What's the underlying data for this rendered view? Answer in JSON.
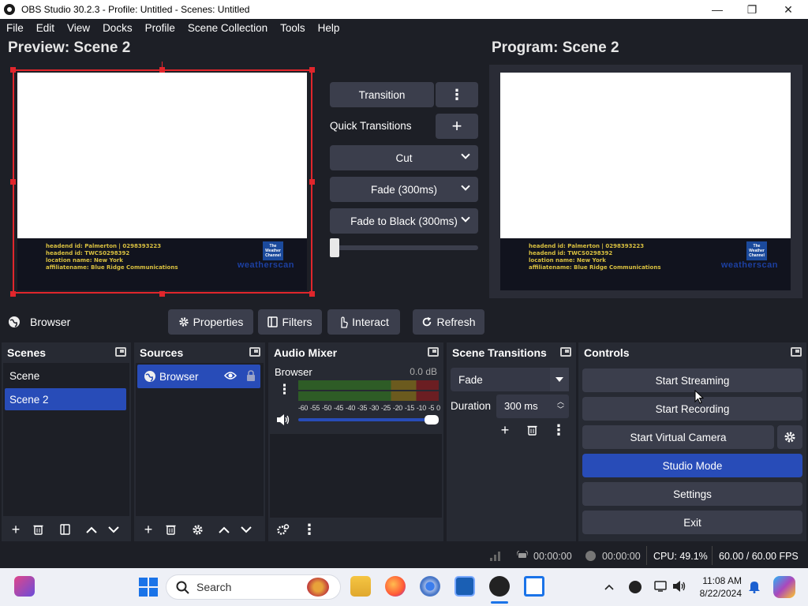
{
  "window": {
    "title": "OBS Studio 30.2.3 - Profile: Untitled - Scenes: Untitled",
    "minimize": "—",
    "maximize": "❐",
    "close": "✕"
  },
  "menu": [
    "File",
    "Edit",
    "View",
    "Docks",
    "Profile",
    "Scene Collection",
    "Tools",
    "Help"
  ],
  "preview": {
    "heading": "Preview: Scene 2"
  },
  "program": {
    "heading": "Program: Scene 2"
  },
  "feed": {
    "lines": [
      "headend id: Palmerton | 0298393223",
      "headend id: TWCS0298392",
      "location name: New York",
      "affiliatename: Blue Ridge Communications"
    ],
    "logo_text": [
      "The",
      "Weather",
      "Channel"
    ],
    "brand": "weatherscan"
  },
  "transitions_center": {
    "transition_button": "Transition",
    "quick_transitions_label": "Quick Transitions",
    "combos": [
      "Cut",
      "Fade (300ms)",
      "Fade to Black (300ms)"
    ],
    "tbar_value": 0
  },
  "context_bar": {
    "source_name": "Browser",
    "buttons": [
      "Properties",
      "Filters",
      "Interact",
      "Refresh"
    ]
  },
  "docks": {
    "scenes": {
      "title": "Scenes",
      "items": [
        "Scene",
        "Scene 2"
      ],
      "selected": "Scene 2"
    },
    "sources": {
      "title": "Sources",
      "items": [
        "Browser"
      ]
    },
    "audio_mixer": {
      "title": "Audio Mixer",
      "channel": "Browser",
      "level": "0.0 dB",
      "scale": [
        "-60",
        "-55",
        "-50",
        "-45",
        "-40",
        "-35",
        "-30",
        "-25",
        "-20",
        "-15",
        "-10",
        "-5",
        "0"
      ],
      "volume": 1.0
    },
    "scene_transitions": {
      "title": "Scene Transitions",
      "selected": "Fade",
      "duration_label": "Duration",
      "duration_value": "300 ms"
    },
    "controls": {
      "title": "Controls",
      "buttons": [
        "Start Streaming",
        "Start Recording",
        "Start Virtual Camera",
        "Studio Mode",
        "Settings",
        "Exit"
      ]
    }
  },
  "status": {
    "stream_time": "00:00:00",
    "record_time": "00:00:00",
    "cpu": "CPU: 49.1%",
    "fps": "60.00 / 60.00 FPS"
  },
  "taskbar": {
    "search_placeholder": "Search",
    "time": "11:08 AM",
    "date": "8/22/2024"
  },
  "colors": {
    "accent": "#284cb8",
    "panel": "#272a33",
    "background": "#1d1f26",
    "button": "#3b3e4c",
    "selection_border": "#e0262c"
  }
}
